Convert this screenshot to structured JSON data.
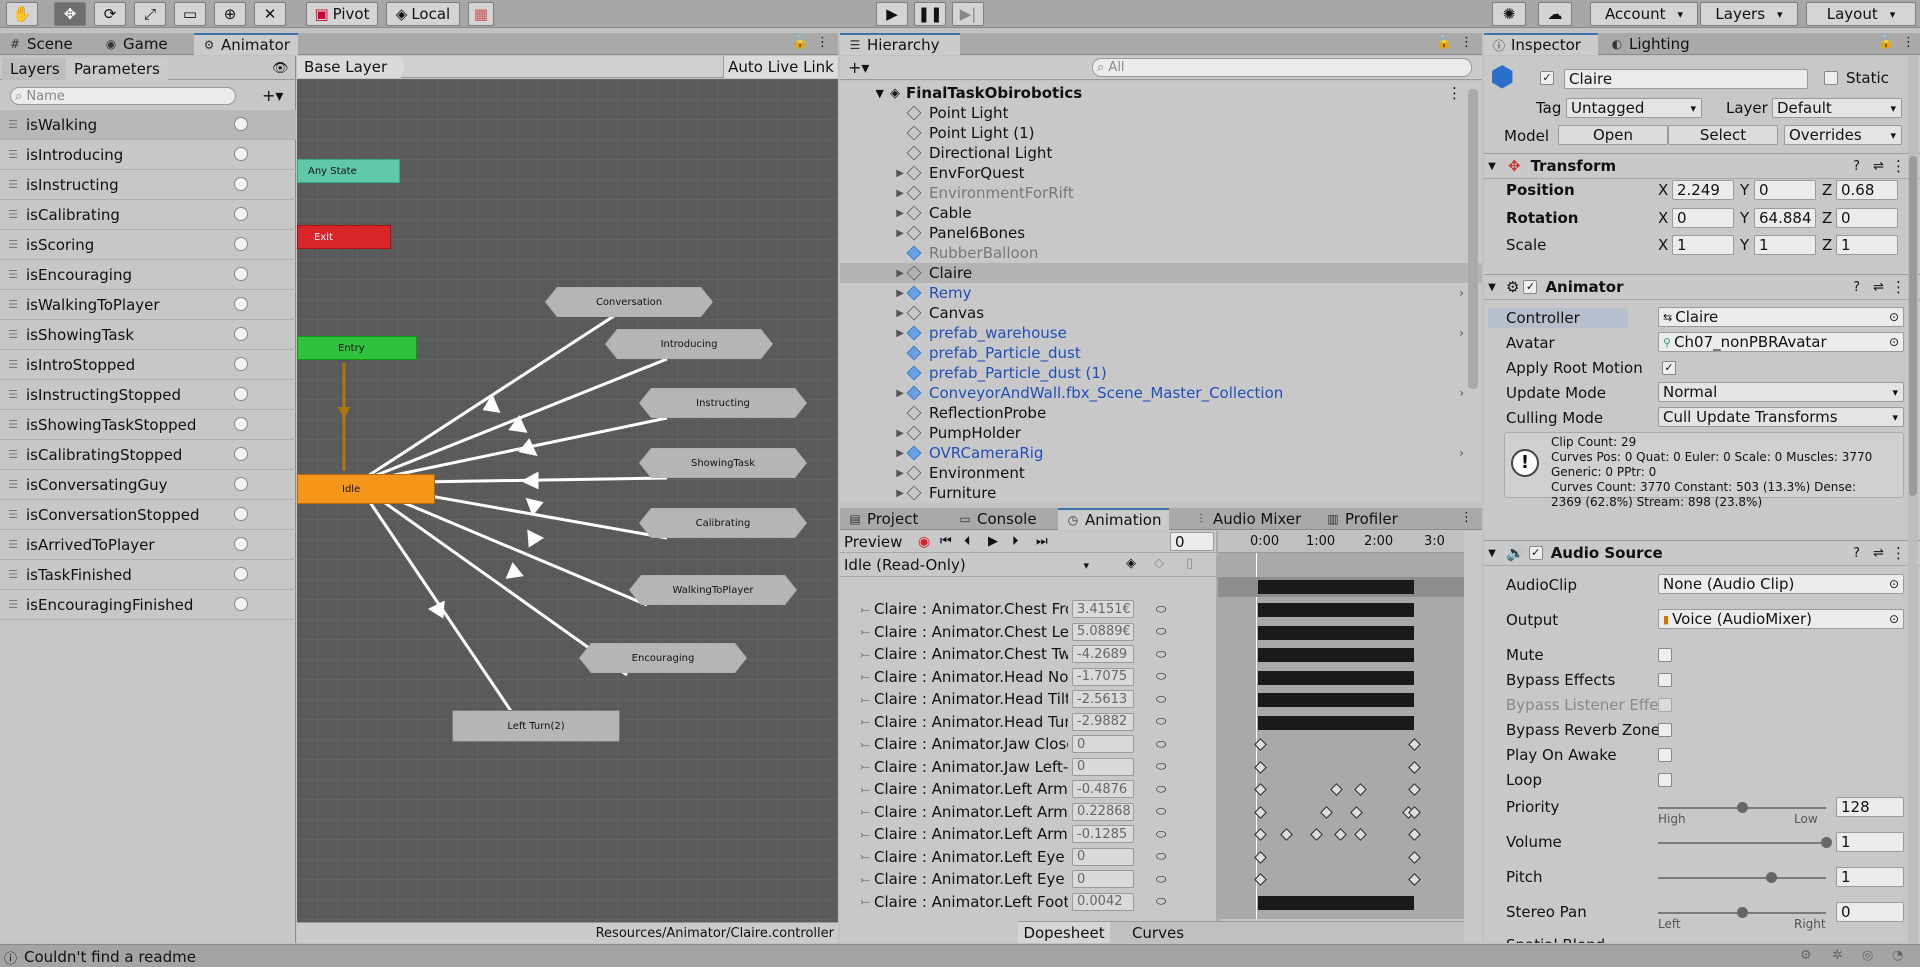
{
  "toolbar": {
    "pivot": "Pivot",
    "local": "Local",
    "account": "Account",
    "layers": "Layers",
    "layout": "Layout"
  },
  "scene_tabs": {
    "scene": "Scene",
    "game": "Game",
    "animator": "Animator"
  },
  "animator": {
    "tab_layers": "Layers",
    "tab_parameters": "Parameters",
    "search_placeholder": "Name",
    "breadcrumb": "Base Layer",
    "auto_live_link": "Auto Live Link",
    "footer_path": "Resources/Animator/Claire.controller",
    "parameters": [
      "isWalking",
      "isIntroducing",
      "isInstructing",
      "isCalibrating",
      "isScoring",
      "isEncouraging",
      "isWalkingToPlayer",
      "isShowingTask",
      "isIntroStopped",
      "isInstructingStopped",
      "isShowingTaskStopped",
      "isCalibratingStopped",
      "isConversatingGuy",
      "isConversationStopped",
      "isArrivedToPlayer",
      "isTaskFinished",
      "isEncouragingFinished"
    ],
    "nodes": {
      "any_state": "Any State",
      "exit": "Exit",
      "entry": "Entry",
      "idle": "Idle",
      "conversation": "Conversation",
      "introducing": "Introducing",
      "instructing": "Instructing",
      "showingtask": "ShowingTask",
      "calibrating": "Calibrating",
      "walkingtoplayer": "WalkingToPlayer",
      "encouraging": "Encouraging",
      "leftturn": "Left Turn(2)"
    }
  },
  "hierarchy": {
    "title": "Hierarchy",
    "search_placeholder": "All",
    "scene": "FinalTaskObirobotics",
    "items": [
      {
        "label": "Point Light",
        "arrow": false,
        "prefab": false,
        "dim": false
      },
      {
        "label": "Point Light (1)",
        "arrow": false,
        "prefab": false,
        "dim": false
      },
      {
        "label": "Directional Light",
        "arrow": false,
        "prefab": false,
        "dim": false
      },
      {
        "label": "EnvForQuest",
        "arrow": true,
        "prefab": false,
        "dim": false
      },
      {
        "label": "EnvironmentForRift",
        "arrow": true,
        "prefab": false,
        "dim": true
      },
      {
        "label": "Cable",
        "arrow": true,
        "prefab": false,
        "dim": false
      },
      {
        "label": "Panel6Bones",
        "arrow": true,
        "prefab": false,
        "dim": false
      },
      {
        "label": "RubberBalloon",
        "arrow": false,
        "prefab": true,
        "dim": true
      },
      {
        "label": "Claire",
        "arrow": true,
        "prefab": false,
        "dim": false
      },
      {
        "label": "Remy",
        "arrow": true,
        "prefab": true,
        "dim": false
      },
      {
        "label": "Canvas",
        "arrow": true,
        "prefab": false,
        "dim": false
      },
      {
        "label": "prefab_warehouse",
        "arrow": true,
        "prefab": true,
        "dim": false
      },
      {
        "label": "prefab_Particle_dust",
        "arrow": false,
        "prefab": true,
        "dim": false
      },
      {
        "label": "prefab_Particle_dust (1)",
        "arrow": false,
        "prefab": true,
        "dim": false
      },
      {
        "label": "ConveyorAndWall.fbx_Scene_Master_Collection",
        "arrow": true,
        "prefab": true,
        "dim": false
      },
      {
        "label": "ReflectionProbe",
        "arrow": false,
        "prefab": false,
        "dim": false
      },
      {
        "label": "PumpHolder",
        "arrow": true,
        "prefab": false,
        "dim": false
      },
      {
        "label": "OVRCameraRig",
        "arrow": true,
        "prefab": true,
        "dim": false
      },
      {
        "label": "Environment",
        "arrow": true,
        "prefab": false,
        "dim": false
      },
      {
        "label": "Furniture",
        "arrow": true,
        "prefab": false,
        "dim": false
      }
    ]
  },
  "bottom_tabs": {
    "project": "Project",
    "console": "Console",
    "animation": "Animation",
    "audio_mixer": "Audio Mixer",
    "profiler": "Profiler"
  },
  "animation": {
    "preview": "Preview",
    "frame": "0",
    "clip": "Idle (Read-Only)",
    "ruler": [
      "0:00",
      "1:00",
      "2:00",
      "3:0"
    ],
    "dopesheet": "Dopesheet",
    "curves": "Curves",
    "properties": [
      {
        "name": "Claire : Animator.Chest Fro",
        "value": "3.4151€"
      },
      {
        "name": "Claire : Animator.Chest Left",
        "value": "5.0889€"
      },
      {
        "name": "Claire : Animator.Chest Twi",
        "value": "-4.2689"
      },
      {
        "name": "Claire : Animator.Head Nod",
        "value": "-1.7075"
      },
      {
        "name": "Claire : Animator.Head Tilt l",
        "value": "-2.5613"
      },
      {
        "name": "Claire : Animator.Head Turn",
        "value": "-2.9882"
      },
      {
        "name": "Claire : Animator.Jaw Close",
        "value": "0"
      },
      {
        "name": "Claire : Animator.Jaw Left-",
        "value": "0"
      },
      {
        "name": "Claire : Animator.Left Arm D",
        "value": "-0.4876"
      },
      {
        "name": "Claire : Animator.Left Arm F",
        "value": "0.22868"
      },
      {
        "name": "Claire : Animator.Left Arm T",
        "value": "-0.1285"
      },
      {
        "name": "Claire : Animator.Left Eye D",
        "value": "0"
      },
      {
        "name": "Claire : Animator.Left Eye Ir",
        "value": "0"
      },
      {
        "name": "Claire : Animator.Left Foot T",
        "value": "0.0042"
      }
    ]
  },
  "inspector": {
    "tab": "Inspector",
    "lighting": "Lighting",
    "object_name": "Claire",
    "static": "Static",
    "tag_label": "Tag",
    "tag": "Untagged",
    "layer_label": "Layer",
    "layer": "Default",
    "model": "Model",
    "open": "Open",
    "select": "Select",
    "overrides": "Overrides",
    "transform": {
      "title": "Transform",
      "position": "Position",
      "rotation": "Rotation",
      "scale": "Scale",
      "pos": [
        "2.249",
        "0",
        "0.68"
      ],
      "rot": [
        "0",
        "64.884",
        "0"
      ],
      "scl": [
        "1",
        "1",
        "1"
      ]
    },
    "animator": {
      "title": "Animator",
      "controller_label": "Controller",
      "controller": "Claire",
      "avatar_label": "Avatar",
      "avatar": "Ch07_nonPBRAvatar",
      "apply_root": "Apply Root Motion",
      "update_label": "Update Mode",
      "update": "Normal",
      "culling_label": "Culling Mode",
      "culling": "Cull Update Transforms",
      "info": [
        "Clip Count: 29",
        "Curves Pos: 0 Quat: 0 Euler: 0 Scale: 0 Muscles: 3770",
        "Generic: 0 PPtr: 0",
        "Curves Count: 3770 Constant: 503 (13.3%) Dense:",
        "2369 (62.8%) Stream: 898 (23.8%)"
      ]
    },
    "audio": {
      "title": "Audio Source",
      "clip_label": "AudioClip",
      "clip": "None (Audio Clip)",
      "output_label": "Output",
      "output": "Voice (AudioMixer)",
      "mute": "Mute",
      "bypass_effects": "Bypass Effects",
      "bypass_listener": "Bypass Listener Effe",
      "bypass_reverb": "Bypass Reverb Zone",
      "play_awake": "Play On Awake",
      "loop": "Loop",
      "priority": "Priority",
      "priority_val": "128",
      "high": "High",
      "low": "Low",
      "volume": "Volume",
      "volume_val": "1",
      "pitch": "Pitch",
      "pitch_val": "1",
      "stereo": "Stereo Pan",
      "stereo_val": "0",
      "left": "Left",
      "right": "Right",
      "spatial": "Spatial Blend"
    }
  },
  "status": {
    "message": "Couldn't find a readme"
  }
}
